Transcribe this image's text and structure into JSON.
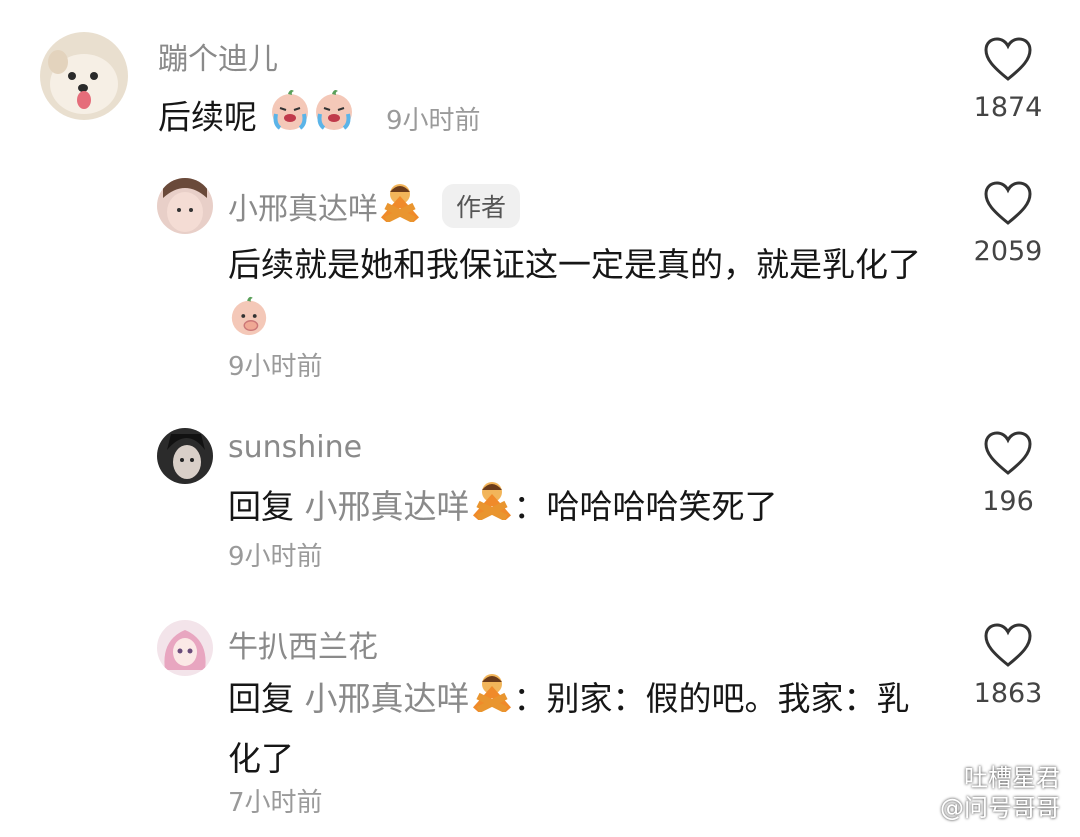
{
  "comments": [
    {
      "username": "蹦个迪儿",
      "text": "后续呢",
      "time": "9小时前",
      "likes": "1874"
    },
    {
      "username": "小邢真达咩",
      "badge": "作者",
      "text": "后续就是她和我保证这一定是真的，就是乳化了",
      "time": "9小时前",
      "likes": "2059"
    },
    {
      "username": "sunshine",
      "reply_prefix": "回复",
      "reply_to": "小邢真达咩",
      "text": "：哈哈哈哈笑死了",
      "time": "9小时前",
      "likes": "196"
    },
    {
      "username": "牛扒西兰花",
      "reply_prefix": "回复",
      "reply_to": "小邢真达咩",
      "text": "：别家：假的吧。我家：乳化了",
      "time": "7小时前",
      "likes": "1863"
    }
  ],
  "watermark": {
    "line1": "吐槽星君",
    "line2": "@问号哥哥"
  }
}
